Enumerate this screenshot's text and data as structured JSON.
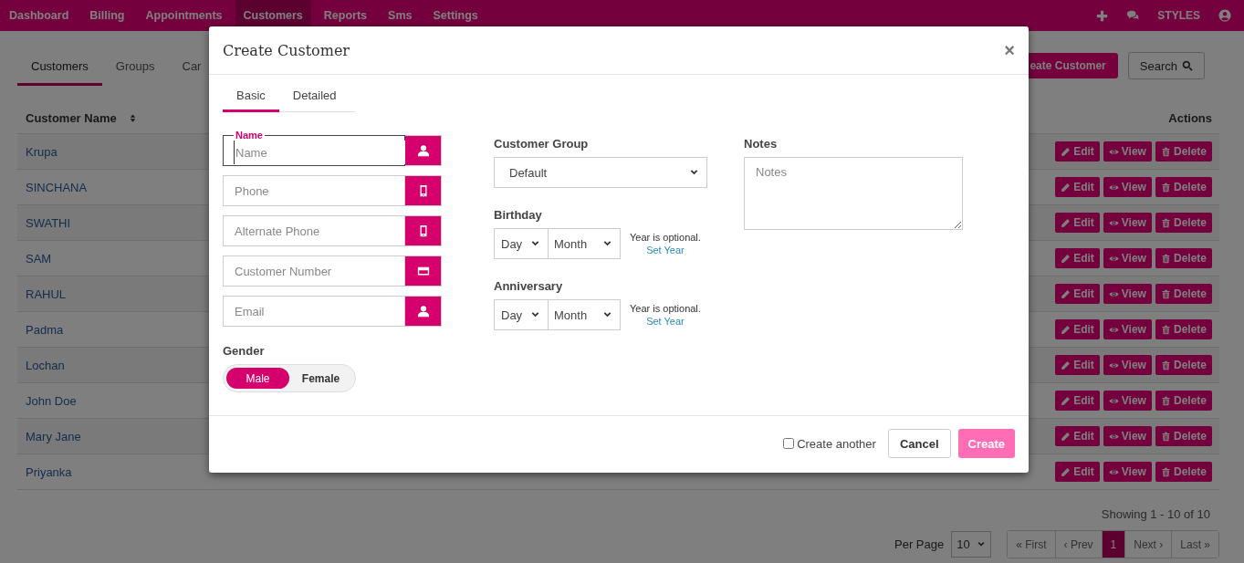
{
  "nav": {
    "items": [
      {
        "label": "Dashboard",
        "selected": false
      },
      {
        "label": "Billing",
        "selected": false
      },
      {
        "label": "Appointments",
        "selected": false
      },
      {
        "label": "Customers",
        "selected": true
      },
      {
        "label": "Reports",
        "selected": false
      },
      {
        "label": "Sms",
        "selected": false
      },
      {
        "label": "Settings",
        "selected": false
      }
    ],
    "styles_label": "STYLES"
  },
  "subnav": {
    "tabs": [
      {
        "label": "Customers",
        "selected": true
      },
      {
        "label": "Groups",
        "selected": false
      },
      {
        "label": "Car",
        "selected": false
      }
    ],
    "create_button": "eate Customer",
    "search_button": "Search"
  },
  "table": {
    "columns": {
      "name": "Customer Name",
      "actions": "Actions"
    },
    "rows": [
      {
        "name": "Krupa",
        "actions": [
          "Edit",
          "View",
          "Delete"
        ]
      },
      {
        "name": "SINCHANA",
        "actions": [
          "Edit",
          "View",
          "Delete"
        ]
      },
      {
        "name": "SWATHI",
        "actions": [
          "Edit",
          "View",
          "Delete"
        ]
      },
      {
        "name": "SAM",
        "actions": [
          "Edit",
          "View",
          "Delete"
        ]
      },
      {
        "name": "RAHUL",
        "actions": [
          "Edit",
          "View",
          "Delete"
        ]
      },
      {
        "name": "Padma",
        "actions": [
          "Edit",
          "View",
          "Delete"
        ]
      },
      {
        "name": "Lochan",
        "actions": [
          "Edit",
          "View",
          "Delete"
        ]
      },
      {
        "name": "John Doe",
        "actions": [
          "Edit",
          "View",
          "Delete"
        ]
      },
      {
        "name": "Mary Jane",
        "actions": [
          "Edit",
          "View",
          "Delete"
        ]
      },
      {
        "name": "Priyanka",
        "actions": [
          "Edit",
          "View",
          "Delete"
        ]
      }
    ]
  },
  "footer": {
    "showing": "Showing 1 - 10 of 10",
    "per_page_label": "Per Page",
    "per_page_value": "10",
    "pager": [
      {
        "label": "« First",
        "selected": false
      },
      {
        "label": "‹ Prev",
        "selected": false
      },
      {
        "label": "1",
        "selected": true
      },
      {
        "label": "Next ›",
        "selected": false
      },
      {
        "label": "Last »",
        "selected": false
      }
    ]
  },
  "modal": {
    "title": "Create Customer",
    "close": "×",
    "tabs": [
      {
        "label": "Basic",
        "selected": true
      },
      {
        "label": "Detailed",
        "selected": false
      }
    ],
    "fields": [
      {
        "placeholder": "Name",
        "kind": "person",
        "focused": true,
        "floating_label": "Name"
      },
      {
        "placeholder": "Phone",
        "kind": "phone",
        "focused": false
      },
      {
        "placeholder": "Alternate Phone",
        "kind": "phone",
        "focused": false
      },
      {
        "placeholder": "Customer Number",
        "kind": "card",
        "focused": false
      },
      {
        "placeholder": "Email",
        "kind": "person",
        "focused": false
      }
    ],
    "gender": {
      "label": "Gender",
      "options": [
        {
          "label": "Male",
          "selected": true
        },
        {
          "label": "Female",
          "selected": false
        }
      ]
    },
    "customer_group": {
      "label": "Customer Group",
      "value": "Default"
    },
    "dates": [
      {
        "label": "Birthday",
        "day": "Day",
        "month": "Month",
        "note": "Year is optional.",
        "link": "Set Year"
      },
      {
        "label": "Anniversary",
        "day": "Day",
        "month": "Month",
        "note": "Year is optional.",
        "link": "Set Year"
      }
    ],
    "notes": {
      "label": "Notes",
      "placeholder": "Notes"
    },
    "create_another": {
      "label": "Create another",
      "checked": false
    },
    "cancel": "Cancel",
    "create": {
      "label": "Create",
      "disabled": true
    }
  }
}
